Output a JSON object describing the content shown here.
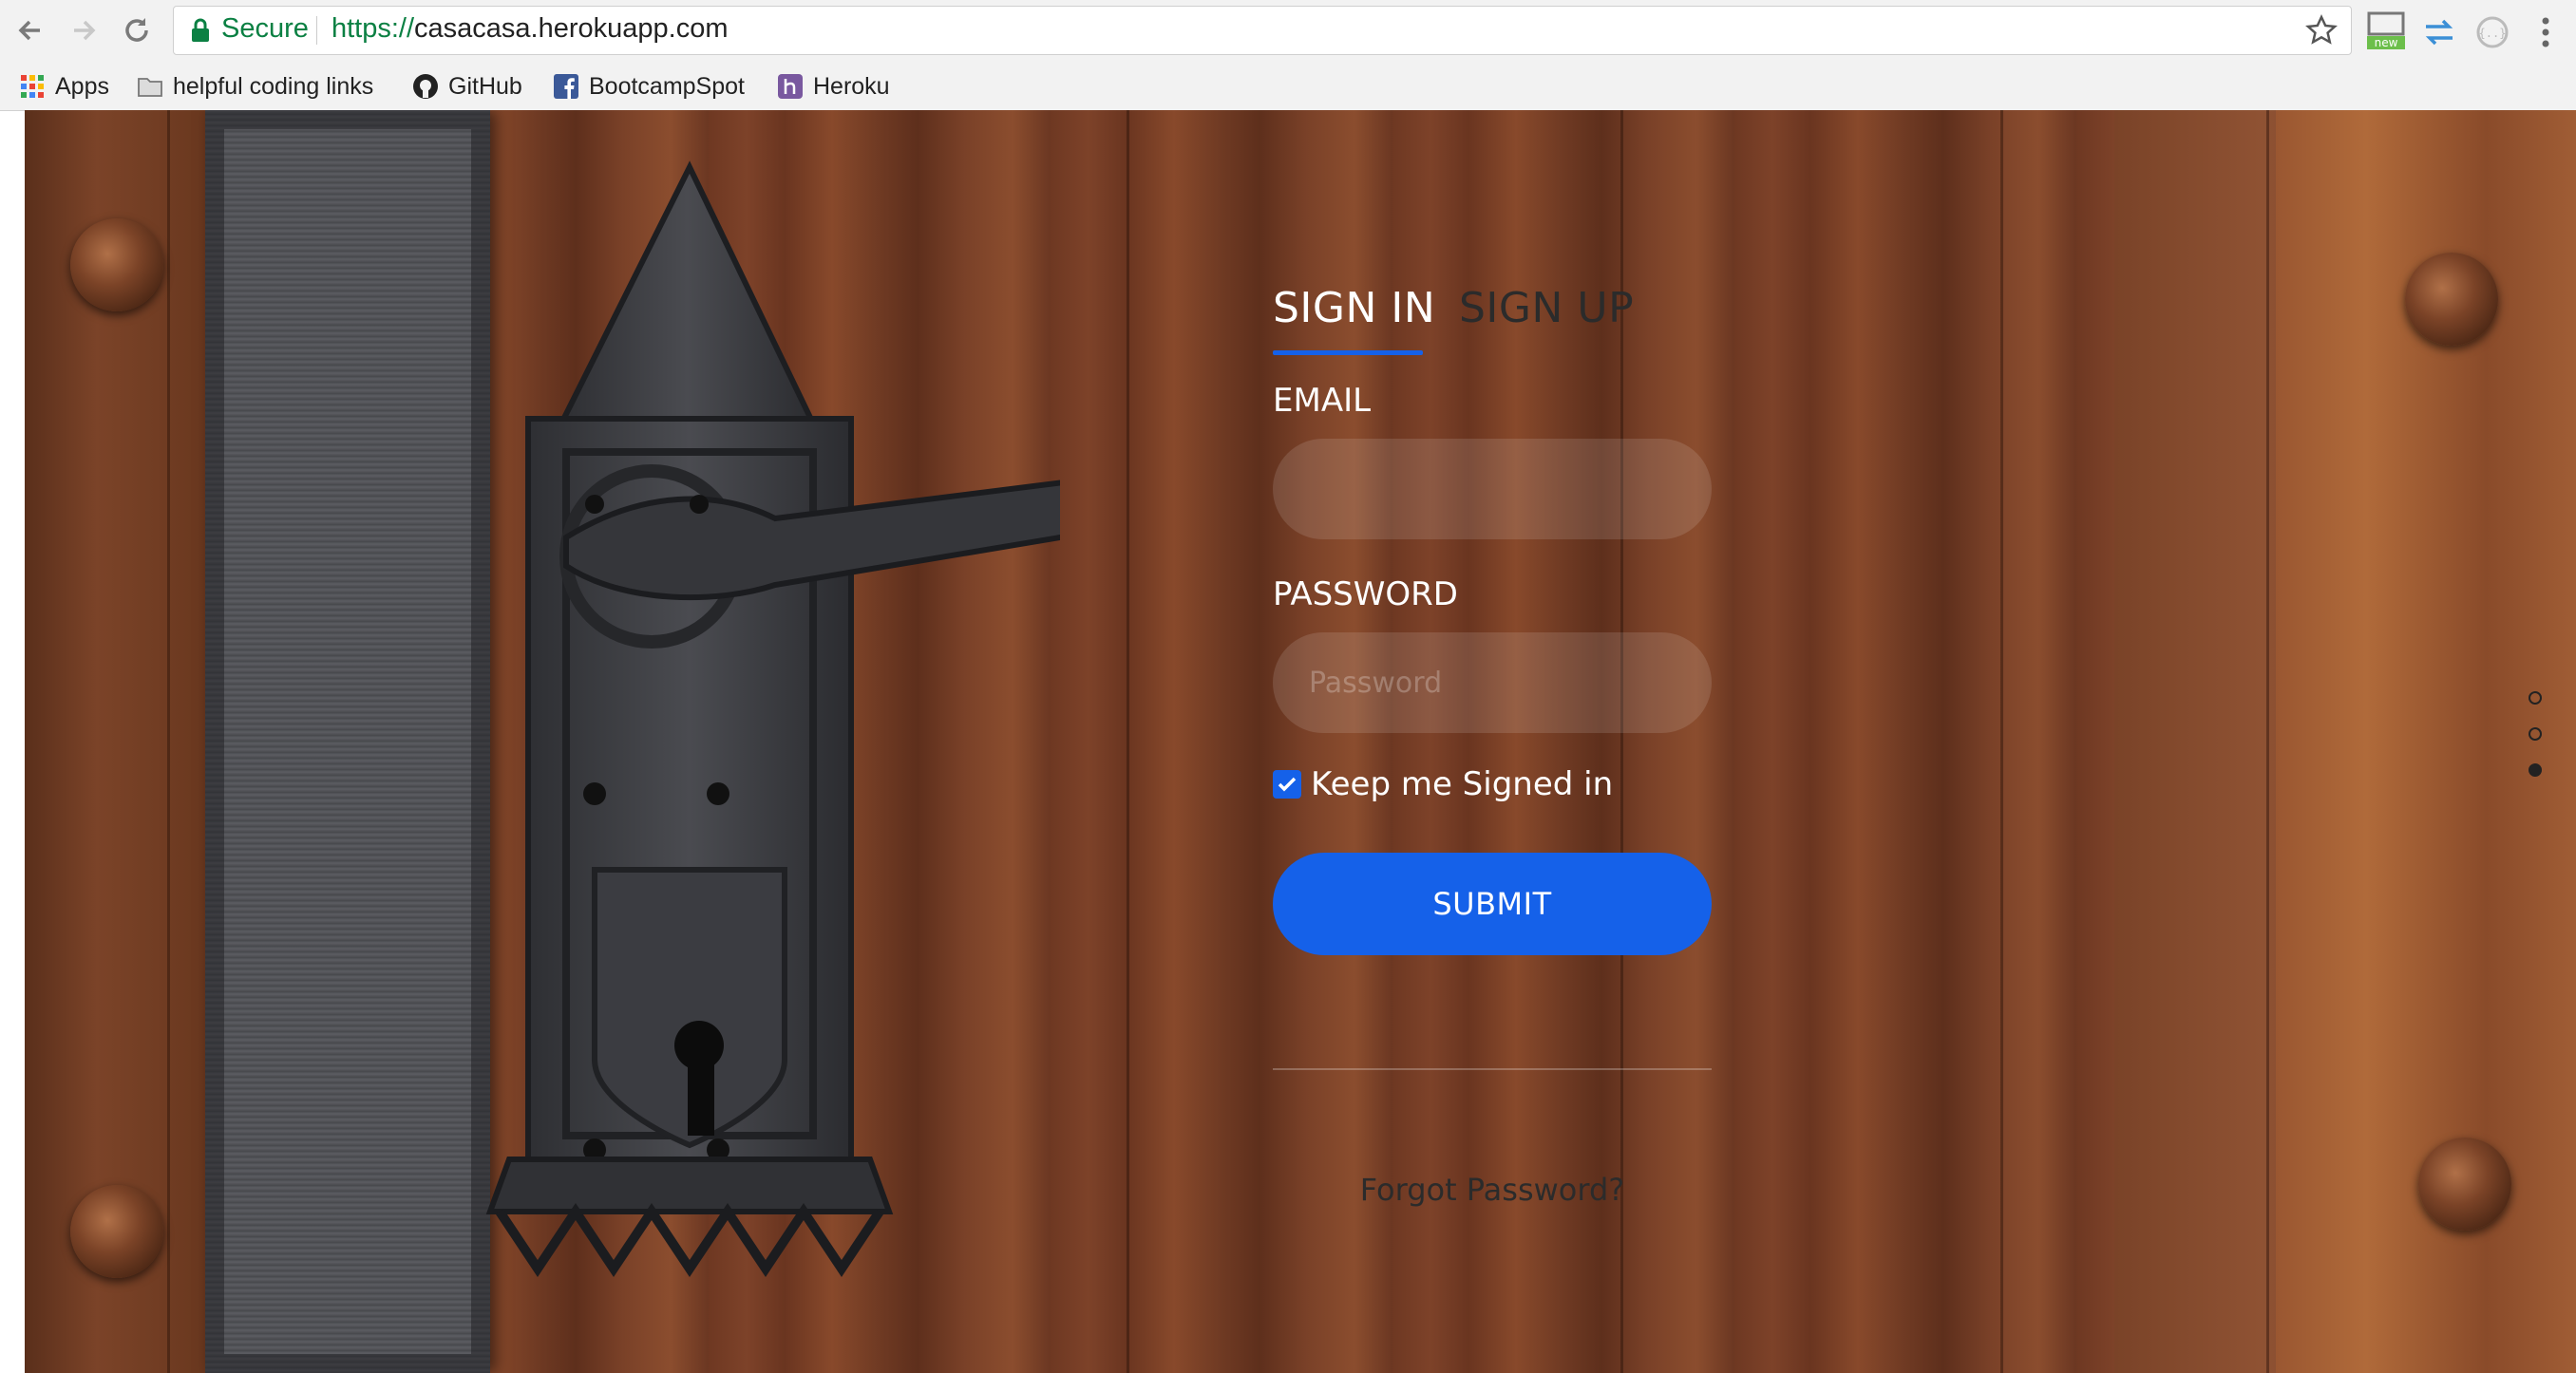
{
  "browser": {
    "security_label": "Secure",
    "url_scheme": "https://",
    "url_host": "casacasa.herokuapp.com",
    "extension_badge": "new"
  },
  "bookmarks": [
    {
      "label": "Apps",
      "icon": "apps-grid-icon"
    },
    {
      "label": "helpful coding links",
      "icon": "folder-icon"
    },
    {
      "label": "GitHub",
      "icon": "github-icon"
    },
    {
      "label": "BootcampSpot",
      "icon": "facebook-icon"
    },
    {
      "label": "Heroku",
      "icon": "heroku-icon"
    }
  ],
  "form": {
    "tabs": [
      {
        "label": "SIGN IN",
        "active": true
      },
      {
        "label": "SIGN UP",
        "active": false
      }
    ],
    "email_label": "EMAIL",
    "email_value": "",
    "password_label": "PASSWORD",
    "password_placeholder": "Password",
    "remember_label": "Keep me Signed in",
    "remember_checked": true,
    "submit_label": "SUBMIT",
    "forgot_label": "Forgot Password?"
  },
  "slider_dots": {
    "count": 3,
    "active_index": 2
  },
  "colors": {
    "accent": "#1561e9",
    "secure_green": "#0b8043",
    "wood": "#7d4229"
  }
}
